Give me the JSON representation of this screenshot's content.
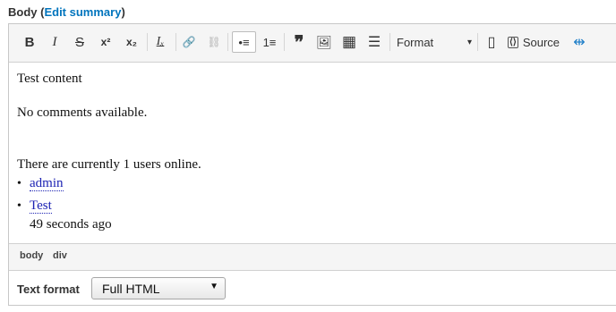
{
  "field": {
    "label": "Body (",
    "link": "Edit summary",
    "close": ")"
  },
  "toolbar": {
    "buttons": [
      {
        "name": "bold-icon",
        "glyph": "B"
      },
      {
        "name": "italic-icon",
        "glyph": "I"
      },
      {
        "name": "strikethrough-icon",
        "glyph": "S"
      },
      {
        "name": "superscript-icon",
        "glyph": "x²"
      },
      {
        "name": "subscript-icon",
        "glyph": "x₂"
      },
      {
        "name": "remove-format-icon",
        "glyph": "Iₓ"
      },
      {
        "name": "link-icon",
        "glyph": "🔗"
      },
      {
        "name": "unlink-icon",
        "glyph": "⛓"
      },
      {
        "name": "bulleted-list-icon",
        "glyph": "•≡"
      },
      {
        "name": "numbered-list-icon",
        "glyph": "1≡"
      },
      {
        "name": "blockquote-icon",
        "glyph": "❞"
      },
      {
        "name": "image-icon",
        "glyph": "🖼"
      },
      {
        "name": "table-icon",
        "glyph": "▦"
      },
      {
        "name": "horizontal-line-icon",
        "glyph": "☰"
      }
    ],
    "format_label": "Format",
    "format_arrow": "▾",
    "show_blocks_glyph": "▯",
    "source_glyph": "⟨⟩",
    "source_label": "Source",
    "extra_glyph": "⇹"
  },
  "content": {
    "line1": "Test content",
    "line2": "No comments available.",
    "line3": "There are currently 1 users online.",
    "bullet": "•",
    "user1": "admin",
    "user2": "Test",
    "user2_time": "49 seconds ago"
  },
  "path_bar": {
    "items": [
      "body",
      "div"
    ]
  },
  "text_format": {
    "label": "Text format",
    "selected": "Full HTML",
    "arrow": "▼"
  }
}
